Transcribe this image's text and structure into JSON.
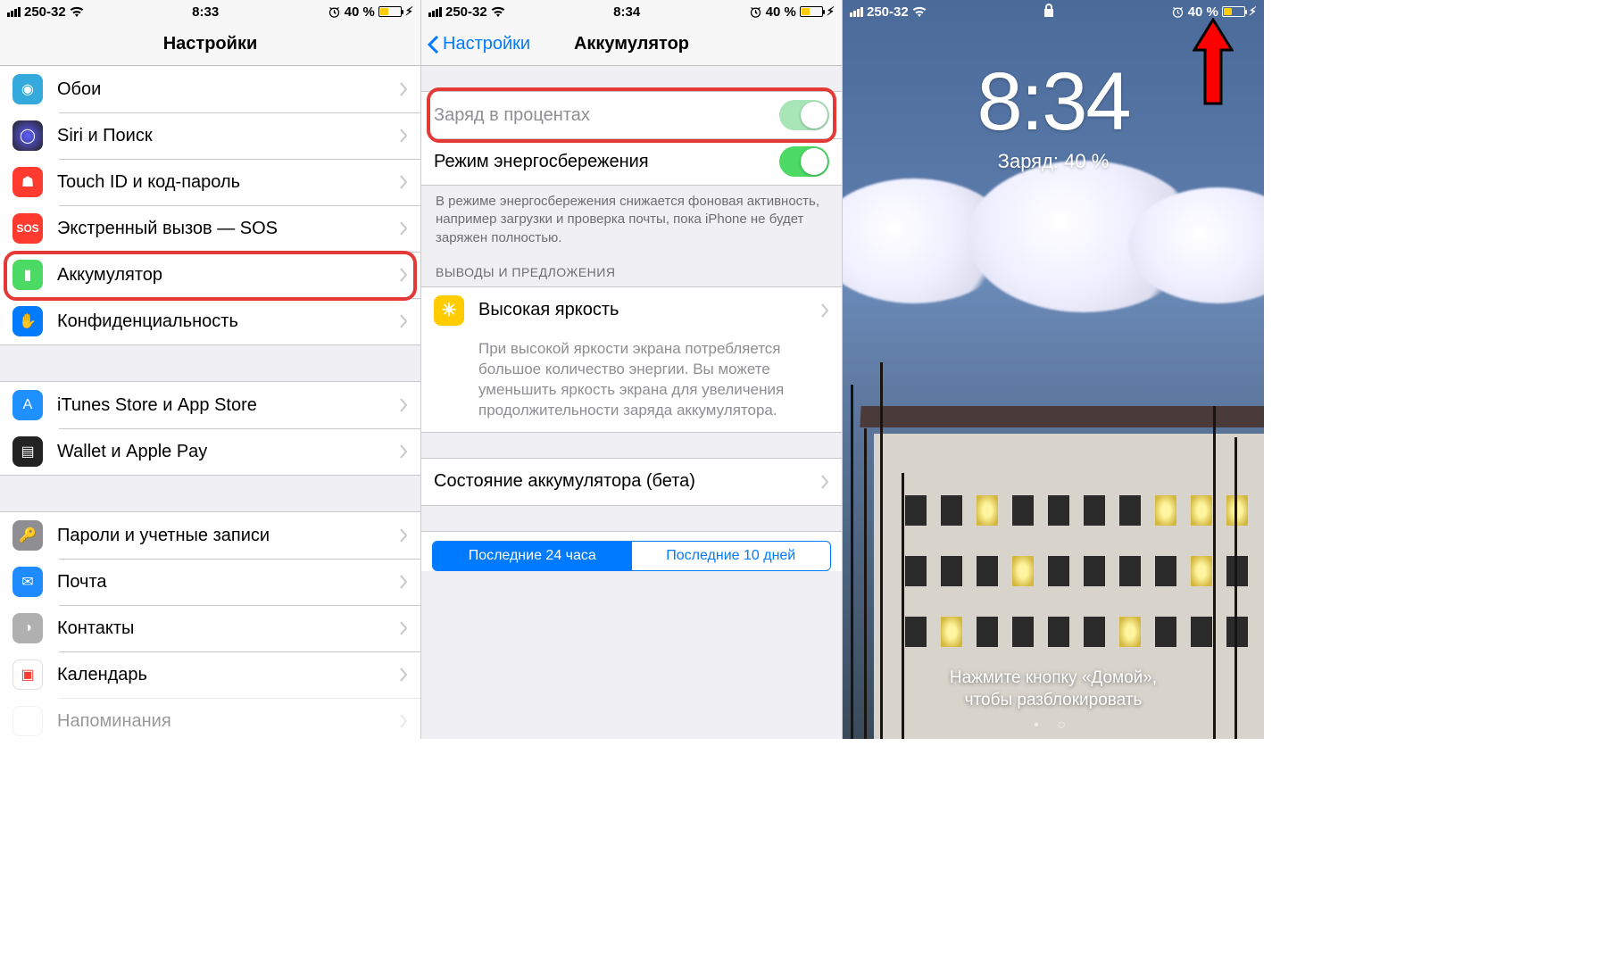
{
  "status": {
    "carrier": "250-32",
    "time1": "8:33",
    "time2": "8:34",
    "battery_pct": "40 %"
  },
  "panel1": {
    "title": "Настройки",
    "items": [
      {
        "label": "Обои",
        "color": "#1fb6ff"
      },
      {
        "label": "Siri и Поиск",
        "color": "#222"
      },
      {
        "label": "Touch ID и код-пароль",
        "color": "#ff3b30"
      },
      {
        "label": "Экстренный вызов — SOS",
        "color": "#ff3b30"
      },
      {
        "label": "Аккумулятор",
        "color": "#4cd964"
      },
      {
        "label": "Конфиденциальность",
        "color": "#007aff"
      }
    ],
    "items2": [
      {
        "label": "iTunes Store и App Store",
        "color": "#1e90ff"
      },
      {
        "label": "Wallet и Apple Pay",
        "color": "#333"
      }
    ],
    "items3": [
      {
        "label": "Пароли и учетные записи",
        "color": "#8e8e93"
      },
      {
        "label": "Почта",
        "color": "#1e8cff"
      },
      {
        "label": "Контакты",
        "color": "#8e8e93"
      },
      {
        "label": "Календарь",
        "color": "#ff3b30"
      },
      {
        "label": "Напоминания",
        "color": "#ff9500"
      }
    ]
  },
  "panel2": {
    "back": "Настройки",
    "title": "Аккумулятор",
    "row_percent": "Заряд в процентах",
    "row_lowpower": "Режим энергосбережения",
    "lowpower_note": "В режиме энергосбережения снижается фоновая активность, например загрузки и проверка почты, пока iPhone не будет заряжен полностью.",
    "insights_header": "ВЫВОДЫ И ПРЕДЛОЖЕНИЯ",
    "insight_title": "Высокая яркость",
    "insight_note": "При высокой яркости экрана потребляется большое количество энергии. Вы можете уменьшить яркость экрана для увеличения продолжительности заряда аккумулятора.",
    "row_health": "Состояние аккумулятора (бета)",
    "seg_a": "Последние 24 часа",
    "seg_b": "Последние 10 дней"
  },
  "panel3": {
    "time": "8:34",
    "charge_line": "Заряд: 40 %",
    "hint_l1": "Нажмите кнопку «Домой»,",
    "hint_l2": "чтобы разблокировать"
  }
}
